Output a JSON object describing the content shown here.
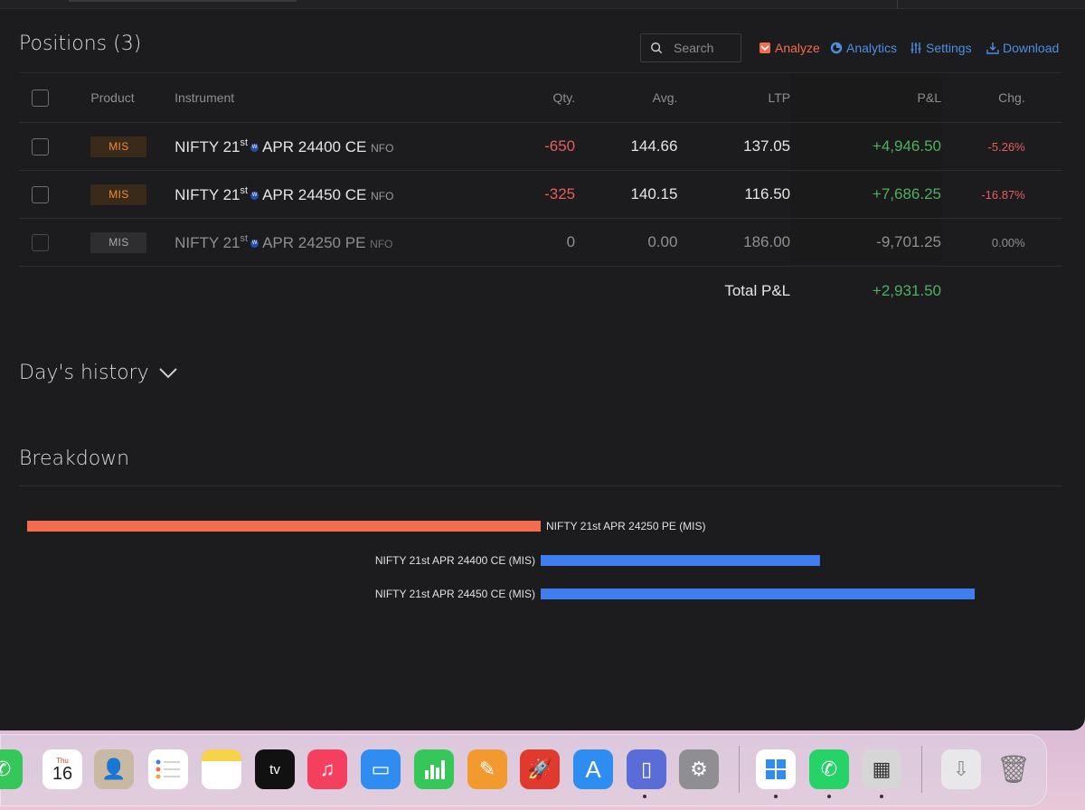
{
  "positions": {
    "title": "Positions (3)",
    "search_placeholder": "Search",
    "toolbar": {
      "analyze": "Analyze",
      "analytics": "Analytics",
      "settings": "Settings",
      "download": "Download"
    },
    "columns": [
      "Product",
      "Instrument",
      "Qty.",
      "Avg.",
      "LTP",
      "P&L",
      "Chg."
    ],
    "rows": [
      {
        "product": "MIS",
        "instrument": "NIFTY 21",
        "sup": "st",
        "weekly": "W",
        "instrument_rest": "APR 24400 CE",
        "exchange": "NFO",
        "qty": "-650",
        "avg": "144.66",
        "ltp": "137.05",
        "pnl": "+4,946.50",
        "chg": "-5.26%"
      },
      {
        "product": "MIS",
        "instrument": "NIFTY 21",
        "sup": "st",
        "weekly": "W",
        "instrument_rest": "APR 24450 CE",
        "exchange": "NFO",
        "qty": "-325",
        "avg": "140.15",
        "ltp": "116.50",
        "pnl": "+7,686.25",
        "chg": "-16.87%"
      },
      {
        "product": "MIS",
        "instrument": "NIFTY 21",
        "sup": "st",
        "weekly": "W",
        "instrument_rest": "APR 24250 PE",
        "exchange": "NFO",
        "qty": "0",
        "avg": "0.00",
        "ltp": "186.00",
        "pnl": "-9,701.25",
        "chg": "0.00%"
      }
    ],
    "total_label": "Total P&L",
    "total_value": "+2,931.50"
  },
  "history": {
    "title": "Day's history"
  },
  "breakdown": {
    "title": "Breakdown"
  },
  "chart_data": {
    "type": "bar",
    "orientation": "horizontal",
    "categories": [
      "NIFTY 21st APR 24250 PE (MIS)",
      "NIFTY 21st APR 24400 CE (MIS)",
      "NIFTY 21st APR 24450 CE (MIS)"
    ],
    "values": [
      -9701.25,
      4946.5,
      7686.25
    ],
    "colors": [
      "#f26c4f",
      "#3f7ef0",
      "#3f7ef0"
    ]
  },
  "dock": {
    "calendar_day": "Thu",
    "calendar_date": "16",
    "apps": [
      "phone-icon",
      "calendar-icon",
      "contacts-icon",
      "reminders-icon",
      "notes-icon",
      "apple-tv-icon",
      "music-icon",
      "keynote-icon",
      "numbers-icon",
      "pages-icon",
      "rocket-icon",
      "app-store-icon",
      "simulator-icon",
      "system-settings-icon",
      "windows-app-icon",
      "whatsapp-icon",
      "calculator-icon",
      "downloads-icon",
      "trash-icon"
    ]
  },
  "colors": {
    "profit": "#4fae62",
    "loss": "#e25f5b",
    "analyze": "#f26c4f",
    "link": "#4a90e2"
  }
}
